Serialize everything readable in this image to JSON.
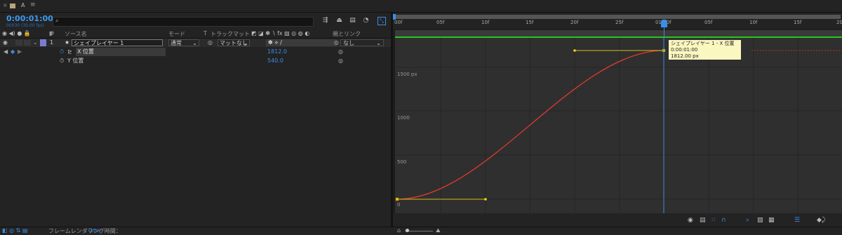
{
  "tab": {
    "close": "×",
    "name": "A",
    "menu": "≡"
  },
  "timecode": "0:00:01:00",
  "fps": "00030 (30.00 fps)",
  "search_icon": "⌕",
  "columns": {
    "source_name": "ソース名",
    "mode": "モード",
    "t": "T",
    "trackmatte": "トラックマット",
    "parent": "親とリンク",
    "num": "#"
  },
  "layer": {
    "index": "1",
    "name": "シェイプレイヤー 1",
    "mode": "通常",
    "matte": "マットなし",
    "parent": "なし",
    "label_color": "#7b7bd6"
  },
  "properties": [
    {
      "name": "X 位置",
      "value": "1812.0"
    },
    {
      "name": "Y 位置",
      "value": "540.0"
    }
  ],
  "status": {
    "label": "フレームレンダリング時間：",
    "value": "0ms"
  },
  "ruler_ticks": [
    "00f",
    "05f",
    "10f",
    "15f",
    "20f",
    "25f",
    "01:00f",
    "05f",
    "10f",
    "15f",
    "20f"
  ],
  "y_labels": [
    "1500 px",
    "1000",
    "500",
    "0"
  ],
  "tooltip": {
    "line1": "シェイプレイヤー 1 - X 位置",
    "line2": "0:00:01:00",
    "line3": "1812.00 px"
  },
  "colors": {
    "accent": "#3a9bf0",
    "curve": "#e33a2c",
    "handle": "#e2c515",
    "bar": "#29c41d",
    "tooltip_bg": "#fbf7c0"
  },
  "icons": [
    "search-icon",
    "comp-flowchart-icon",
    "shy-icon",
    "frame-blend-icon",
    "motion-blur-icon",
    "graph-editor-icon",
    "eye-icon",
    "snapping-icon",
    "fit-icon"
  ]
}
